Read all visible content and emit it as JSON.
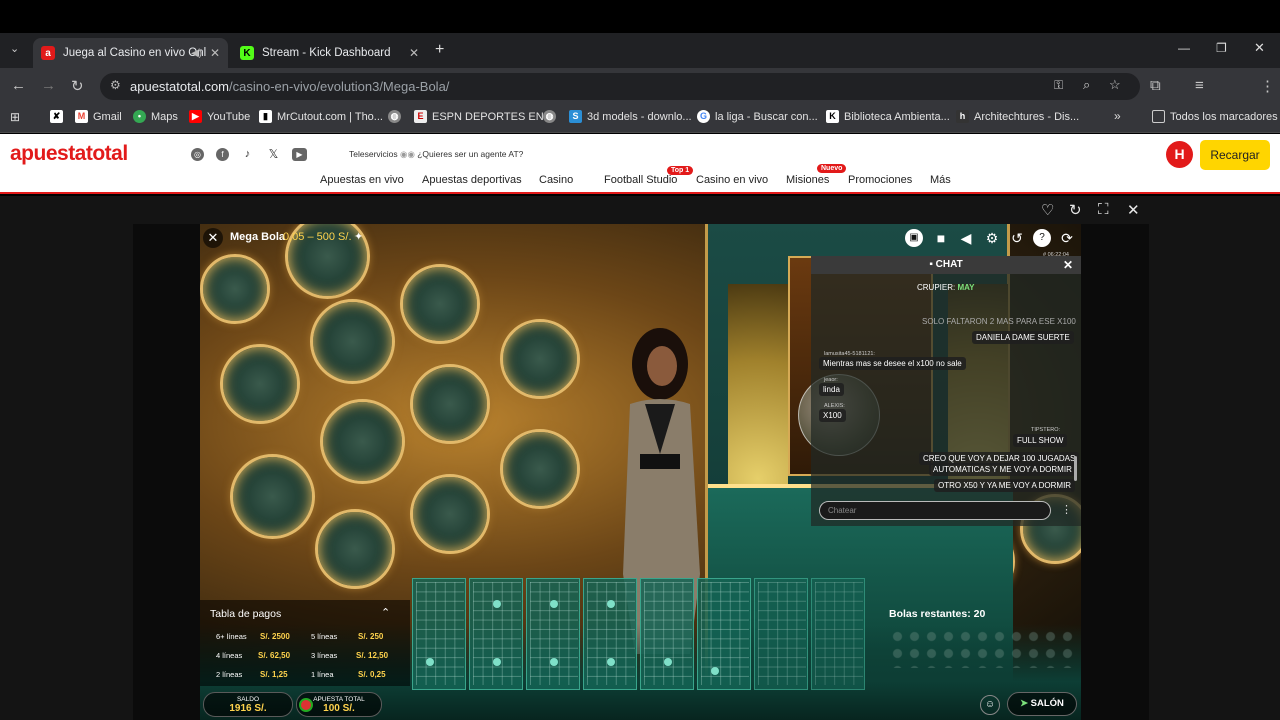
{
  "browser": {
    "tabs": [
      {
        "title": "Juega al Casino en vivo Onl",
        "active": true
      },
      {
        "title": "Stream - Kick Dashboard",
        "active": false
      }
    ],
    "url_host": "apuestatotal.com",
    "url_path": "/casino-en-vivo/evolution3/Mega-Bola/",
    "bookmarks": [
      "Gmail",
      "Maps",
      "YouTube",
      "MrCutout.com | Tho...",
      "ESPN DEPORTES EN...",
      "3d models - downlo...",
      "la liga - Buscar con...",
      "Biblioteca Ambienta...",
      "Architechtures - Dis..."
    ],
    "all_bookmarks": "Todos los marcadores"
  },
  "site": {
    "logo": "apuestatotal",
    "teleservicios": "Teleservicios",
    "agent_prompt": "¿Quieres ser un agente AT?",
    "menu": [
      "Apuestas en vivo",
      "Apuestas deportivas",
      "Casino",
      "Football Studio",
      "Casino en vivo",
      "Misiones",
      "Promociones",
      "Más"
    ],
    "badge_top": "Top 1",
    "badge_new": "Nuevo",
    "avatar": "H",
    "recharge": "Recargar"
  },
  "game": {
    "title": "Mega Bola",
    "limits": "0,05 – 500 S/.",
    "timestamp": "# 06:22:04",
    "chat": {
      "header": "CHAT",
      "dealer_label": "CRUPIER:",
      "dealer_name": "MAY",
      "messages": [
        {
          "user": "",
          "text": "SOLO FALTARON 2 MAS PARA ESE X100"
        },
        {
          "user": "",
          "text": "DANIELA DAME SUERTE"
        },
        {
          "user": "lamusita45-5181121:",
          "text": "Mientras mas se desee el x100 no sale"
        },
        {
          "user": "jeaor:",
          "text": "linda"
        },
        {
          "user": "ALEXIS:",
          "text": "X100"
        },
        {
          "user": "TIPSTERO:",
          "text": "FULL SHOW"
        },
        {
          "user": "",
          "text": "CREO QUE VOY A DEJAR 100 JUGADAS"
        },
        {
          "user": "",
          "text": "AUTOMATICAS Y ME VOY A DORMIR"
        },
        {
          "user": "",
          "text": "OTRO X50 Y YA ME VOY A DORMIR"
        }
      ],
      "input_placeholder": "Chatear"
    },
    "paytable": {
      "title": "Tabla de pagos",
      "rows": [
        {
          "l1": "6+ líneas",
          "v1": "S/. 2500",
          "l2": "5 líneas",
          "v2": "S/. 250"
        },
        {
          "l1": "4 líneas",
          "v1": "S/. 62,50",
          "l2": "3 líneas",
          "v2": "S/. 12,50"
        },
        {
          "l1": "2 líneas",
          "v1": "S/. 1,25",
          "l2": "1 línea",
          "v2": "S/. 0,25"
        }
      ]
    },
    "balls_remaining_label": "Bolas restantes: 20",
    "balance_label": "SALDO",
    "balance_value": "1916 S/.",
    "total_bet_label": "APUESTA TOTAL",
    "total_bet_value": "100 S/.",
    "lobby": "SALÓN"
  }
}
